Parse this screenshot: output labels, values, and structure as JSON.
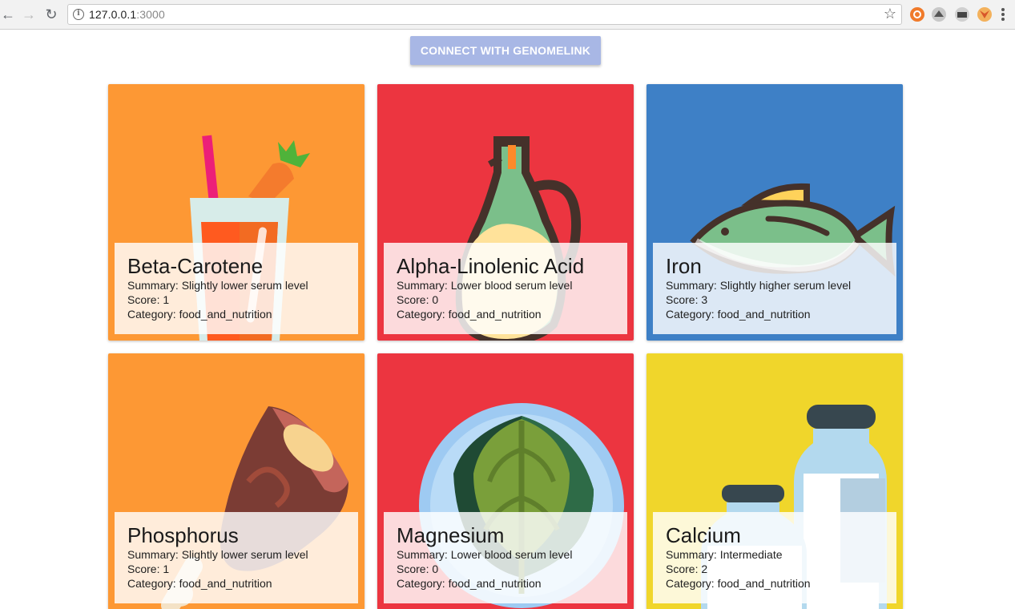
{
  "browser": {
    "url_host": "127.0.0.1",
    "url_port": ":3000",
    "back_icon": "arrow-left-icon",
    "forward_icon": "arrow-right-icon",
    "reload_icon": "reload-icon",
    "bookmark_icon": "star-icon",
    "extension_icons": [
      "extension-orange-icon",
      "extension-gray-icon",
      "extension-dark-icon",
      "extension-fox-icon"
    ]
  },
  "connect_button": {
    "label": "CONNECT WITH GENOMELINK",
    "color": "#a8b7e5"
  },
  "labels": {
    "summary": "Summary: ",
    "score": "Score: ",
    "category": "Category: "
  },
  "cards": [
    {
      "title": "Beta-Carotene",
      "summary": "Slightly lower serum level",
      "score": "1",
      "category": "food_and_nutrition",
      "bg": "#fd9834",
      "illustration": "carrot-juice-icon"
    },
    {
      "title": "Alpha-Linolenic Acid",
      "summary": "Lower blood serum level",
      "score": "0",
      "category": "food_and_nutrition",
      "bg": "#ec3540",
      "illustration": "oil-bottle-icon"
    },
    {
      "title": "Iron",
      "summary": "Slightly higher serum level",
      "score": "3",
      "category": "food_and_nutrition",
      "bg": "#3e80c6",
      "illustration": "fish-icon"
    },
    {
      "title": "Phosphorus",
      "summary": "Slightly lower serum level",
      "score": "1",
      "category": "food_and_nutrition",
      "bg": "#fd9834",
      "illustration": "meat-icon"
    },
    {
      "title": "Magnesium",
      "summary": "Lower blood serum level",
      "score": "0",
      "category": "food_and_nutrition",
      "bg": "#ec3540",
      "illustration": "spinach-plate-icon"
    },
    {
      "title": "Calcium",
      "summary": "Intermediate",
      "score": "2",
      "category": "food_and_nutrition",
      "bg": "#f0d62b",
      "illustration": "milk-bottles-icon"
    }
  ]
}
